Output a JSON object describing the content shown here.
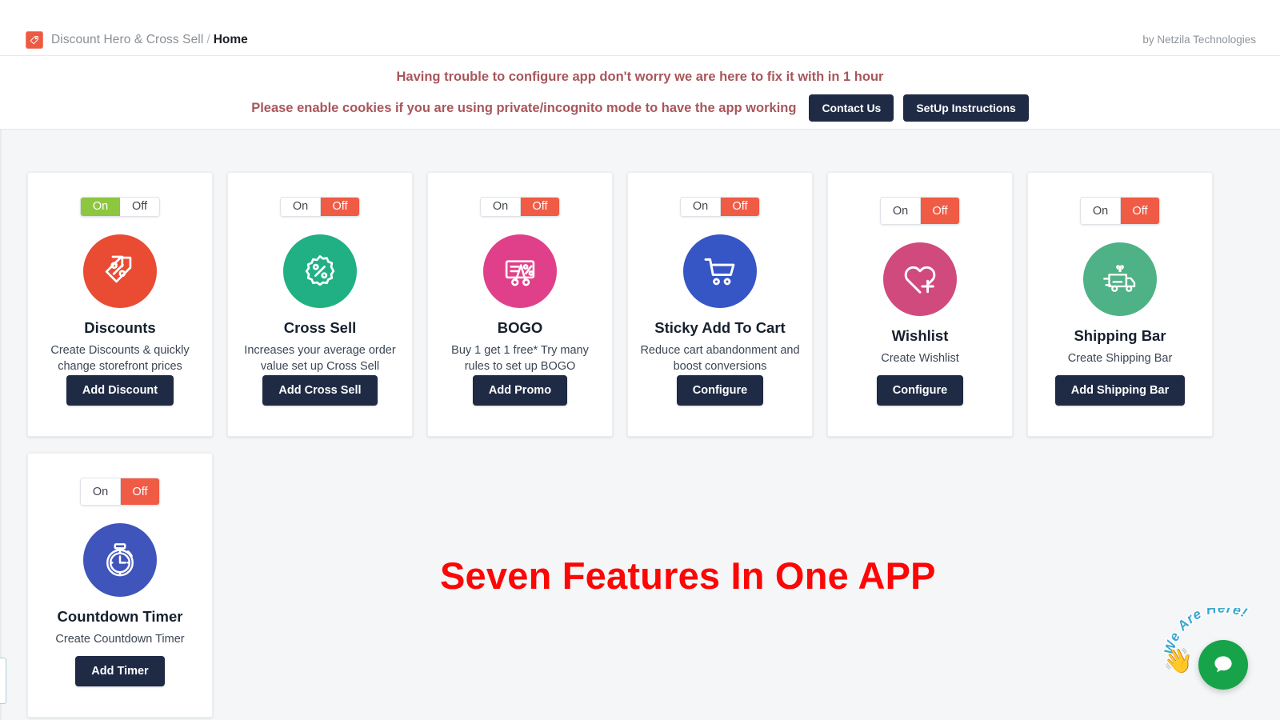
{
  "header": {
    "logo_icon": "discount-tag-logo-icon",
    "app_name": "Discount Hero & Cross Sell",
    "separator": "/",
    "current_page": "Home",
    "attribution": "by Netzila Technologies"
  },
  "notice": {
    "line1": "Having trouble to configure app don't worry we are here to fix it with in 1 hour",
    "line2": "Please enable cookies if you are using private/incognito mode to have the app working",
    "contact_button": "Contact Us",
    "setup_button": "SetUp Instructions",
    "text_color": "#a8565b",
    "button_color": "#1f2b45"
  },
  "toggle": {
    "on_label": "On",
    "off_label": "Off",
    "on_color": "#8dc63f",
    "off_color": "#ef5b45"
  },
  "cards": [
    {
      "id": "discounts",
      "state": "On",
      "icon": "discount-tags-icon",
      "icon_color": "#ea4b33",
      "title": "Discounts",
      "desc": "Create Discounts & quickly change storefront prices",
      "button": "Add Discount"
    },
    {
      "id": "cross-sell",
      "state": "Off",
      "icon": "percent-badge-icon",
      "icon_color": "#20b083",
      "title": "Cross Sell",
      "desc": "Increases your average order value set up Cross Sell",
      "button": "Add Cross Sell"
    },
    {
      "id": "bogo",
      "state": "Off",
      "icon": "coupon-scissors-icon",
      "icon_color": "#e0408a",
      "title": "BOGO",
      "desc": "Buy 1 get 1 free* Try many rules to set up BOGO",
      "button": "Add Promo"
    },
    {
      "id": "sticky-add-to-cart",
      "state": "Off",
      "icon": "shopping-cart-icon",
      "icon_color": "#3556c4",
      "title": "Sticky Add To Cart",
      "desc": "Reduce cart abandonment and boost conversions",
      "button": "Configure"
    },
    {
      "id": "wishlist",
      "state": "Off",
      "icon": "heart-plus-icon",
      "icon_color": "#d04a7e",
      "title": "Wishlist",
      "desc": "Create Wishlist",
      "button": "Configure"
    },
    {
      "id": "shipping-bar",
      "state": "Off",
      "icon": "gift-truck-icon",
      "icon_color": "#4fb286",
      "title": "Shipping Bar",
      "desc": "Create Shipping Bar",
      "button": "Add Shipping Bar"
    },
    {
      "id": "countdown-timer",
      "state": "Off",
      "icon": "stopwatch-icon",
      "icon_color": "#3f55bb",
      "title": "Countdown Timer",
      "desc": "Create Countdown Timer",
      "button": "Add Timer"
    }
  ],
  "hero": {
    "text": "Seven Features In One APP",
    "color": "#fc0606"
  },
  "chat": {
    "label": "We Are Here!",
    "bubble_icon": "chat-bubble-icon",
    "hand_icon": "waving-hand-icon",
    "bubble_color": "#16a34a",
    "label_color": "#2196c4"
  }
}
